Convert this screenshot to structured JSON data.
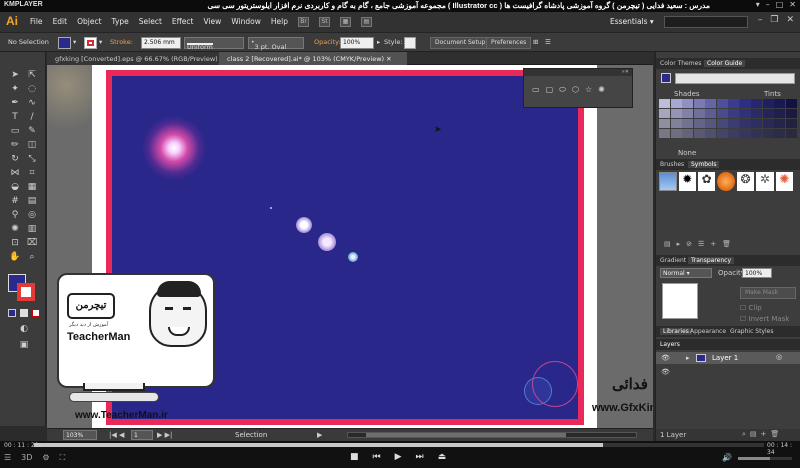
{
  "player": {
    "name": "KMPLAYER",
    "title": "مجموعه آموزشی جامع ، گام به گام و کاربردی نرم افزار ایلوستریتور سی سی ( Illustrator cc ) مدرس : سعید فدایی ( تیچرمن ) گروه آموزشی پادشاه گرافیست ها",
    "time_elapsed": "00 : 11 : 20",
    "time_total": "00 : 14 : 34",
    "progress_fraction": 0.78,
    "volume_fraction": 0.6
  },
  "app": {
    "logo": "Ai",
    "menu": [
      "File",
      "Edit",
      "Object",
      "Type",
      "Select",
      "Effect",
      "View",
      "Window",
      "Help"
    ],
    "menu_icons": [
      "Br",
      "St"
    ],
    "workspace": "Essentials"
  },
  "control_bar": {
    "selection_label": "No Selection",
    "stroke_label": "Stroke:",
    "stroke_weight": "2.506 mm",
    "stroke_profile": "Uniform",
    "brush": "3 pt. Oval",
    "opacity_label": "Opacity:",
    "opacity_value": "100%",
    "style_label": "Style:",
    "document_setup": "Document Setup",
    "preferences": "Preferences",
    "fill_color": "#2a2a8c",
    "stroke_color": "#d32f2f"
  },
  "tabs": [
    {
      "label": "gfxking [Converted].eps @ 66.67% (RGB/Preview)",
      "active": false
    },
    {
      "label": "class 2 [Recovered].ai* @ 103% (CMYK/Preview)",
      "active": true
    }
  ],
  "canvas": {
    "artboard_color": "#29278a",
    "frame_color": "#e8295a",
    "watermark_main": "TeacherMan",
    "watermark_fa": "تیچرمن",
    "watermark_sub": "آموزش از دید دیگر",
    "watermark_url": "www.TeacherMan.ir",
    "gfx_name": "سعید فدائی",
    "gfx_url": "www.GfxKing.ir"
  },
  "status": {
    "zoom": "103%",
    "page": "1",
    "tool": "Selection"
  },
  "panels": {
    "color_tabs": [
      "Color Themes",
      "Color Guide"
    ],
    "shades": "Shades",
    "tints": "Tints",
    "none": "None",
    "guide_colors": [
      "#bdbdda",
      "#a7a7cf",
      "#9090c2",
      "#7a7ab5",
      "#6464a8",
      "#4e4e9b",
      "#3b3b8f",
      "#2e2e84",
      "#262673",
      "#1f1f62",
      "#181852",
      "#121242"
    ],
    "brush_tabs": [
      "Brushes",
      "Symbols"
    ],
    "trans_tabs": [
      "Gradient",
      "Transparency"
    ],
    "blend_mode": "Normal",
    "opacity_label": "Opacity:",
    "opacity_value": "100%",
    "make_mask": "Make Mask",
    "clip": "Clip",
    "invert_mask": "Invert Mask",
    "lib_tabs": [
      "Libraries",
      "Appearance",
      "Graphic Styles"
    ],
    "layers_title": "Layers",
    "layer_name": "Layer 1",
    "layer_count": "1 Layer"
  }
}
